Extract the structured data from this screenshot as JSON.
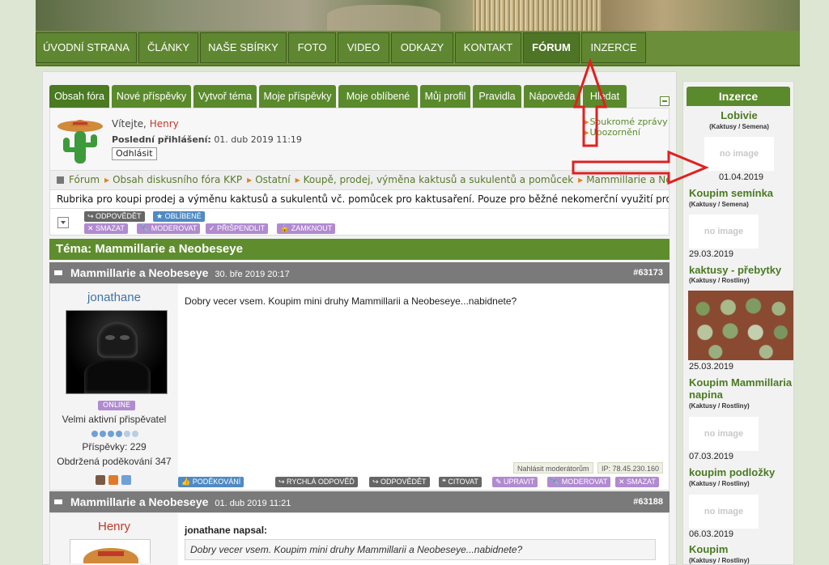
{
  "topnav": {
    "items": [
      "ÚVODNÍ STRANA",
      "ČLÁNKY",
      "NAŠE SBÍRKY",
      "FOTO",
      "VIDEO",
      "ODKAZY",
      "KONTAKT",
      "FÓRUM",
      "INZERCE"
    ],
    "active": "FÓRUM"
  },
  "tabs": [
    "Obsah fóra",
    "Nové příspěvky",
    "Vytvoř téma",
    "Moje příspěvky",
    "Moje oblíbené",
    "Můj profil",
    "Pravidla",
    "Nápověda",
    "Hledat"
  ],
  "user": {
    "welcome_prefix": "Vítejte,",
    "name": "Henry",
    "last_login_label": "Poslední přihlášení:",
    "last_login": "01. dub 2019 11:19",
    "logout": "Odhlásit",
    "links": [
      "Soukromé zprávy",
      "Upozornění"
    ]
  },
  "breadcrumb": [
    "Fórum",
    "Obsah diskusního fóra KKP",
    "Ostatní",
    "Koupě, prodej, výměna kaktusů a sukulentů a pomůcek",
    "Mammillarie a Neobeseye"
  ],
  "rubrika": "Rubrika pro koupi prodej a výměnu kaktusů a sukulentů vč. pomůcek pro kaktusaření. Pouze pro běžné nekomerční využití pro členy fóra !!!",
  "toolbar": {
    "reply": "ODPOVĚDĚT",
    "favorite": "OBLÍBENÉ",
    "delete": "SMAZAT",
    "moderate": "MODEROVAT",
    "pin": "PŘIŠPENDLIT",
    "lock": "ZAMKNOUT"
  },
  "topic": {
    "label": "Téma: Mammillarie a Neobeseye"
  },
  "posts": [
    {
      "title": "Mammillarie a Neobeseye",
      "date": "30. bře 2019 20:17",
      "id": "#63173",
      "author": "jonathane",
      "status": "ONLINE",
      "rank": "Velmi aktivní přispěvatel",
      "posts_count": "Příspěvky: 229",
      "thanks": "Obdržená poděkování 347",
      "body": "Dobry vecer vsem. Koupim mini druhy Mammillarii a Neobeseye...nabidnete?",
      "report": "Nahlásit moderátorům",
      "ip": "IP: 78.45.230.160",
      "actions": {
        "thank": "PODĚKOVÁNÍ",
        "quick_reply": "RYCHLÁ ODPOVĚĎ",
        "reply": "ODPOVĚDĚT",
        "quote": "CITOVAT",
        "edit": "UPRAVIT",
        "moderate": "MODEROVAT",
        "delete": "SMAZAT"
      }
    },
    {
      "title": "Mammillarie a Neobeseye",
      "date": "01. dub 2019 11:21",
      "id": "#63188",
      "author": "Henry",
      "quote_author": "jonathane napsal:",
      "quote_text": "Dobry vecer vsem. Koupim mini druhy Mammillarii a Neobeseye...nabidnete?"
    }
  ],
  "sidebar": {
    "title": "Inzerce",
    "ads": [
      {
        "title": "Lobivie",
        "cat": "(Kaktusy / Semena)",
        "img": "no image",
        "date": "01.04.2019"
      },
      {
        "title": "Koupim semínka",
        "cat": "(Kaktusy / Semena)",
        "img": "no image",
        "date": "29.03.2019"
      },
      {
        "title": "kaktusy - přebytky",
        "cat": "(Kaktusy / Rostliny)",
        "img": "",
        "date": "25.03.2019"
      },
      {
        "title": "Koupim Mammillaria napina",
        "cat": "(Kaktusy / Rostliny)",
        "img": "no image",
        "date": "07.03.2019"
      },
      {
        "title": "koupim podložky",
        "cat": "(Kaktusy / Rostliny)",
        "img": "no image",
        "date": "06.03.2019"
      },
      {
        "title": "Koupim",
        "cat": "(Kaktusy / Rostliny)"
      }
    ]
  },
  "colors": {
    "nav_green": "#6b8e3a",
    "tab_green": "#5a8a2b",
    "annotation_red": "#e02020"
  }
}
